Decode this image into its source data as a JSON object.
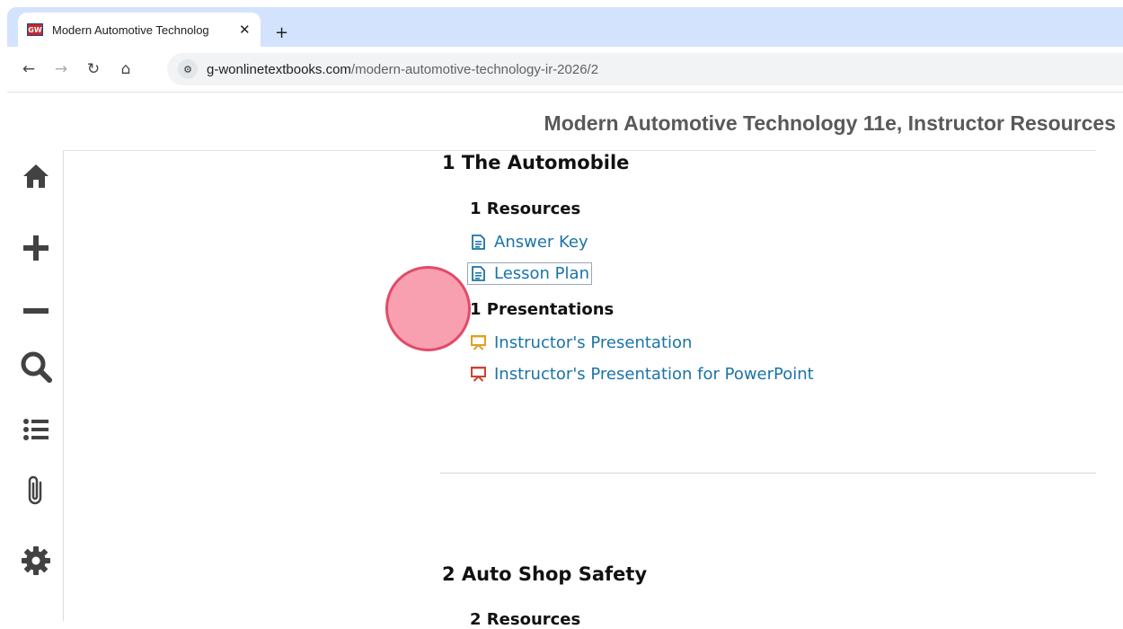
{
  "browser": {
    "tab": {
      "favicon_text": "GW",
      "title": "Modern Automotive Technolog",
      "close_glyph": "✕"
    },
    "new_tab_glyph": "+",
    "nav": {
      "back_glyph": "←",
      "forward_glyph": "→",
      "reload_glyph": "↻",
      "home_glyph": "⌂"
    },
    "address": {
      "site_info_glyph": "⚙",
      "host": "g-wonlinetextbooks.com",
      "path": "/modern-automotive-technology-ir-2026/2"
    }
  },
  "page": {
    "book_title": "Modern Automotive Technology 11e, Instructor Resources",
    "sidebar": {
      "items": [
        {
          "name": "home-icon"
        },
        {
          "name": "zoom-in-icon"
        },
        {
          "name": "zoom-out-icon"
        },
        {
          "name": "search-icon"
        },
        {
          "name": "list-icon"
        },
        {
          "name": "paperclip-icon"
        },
        {
          "name": "gear-icon"
        }
      ],
      "icon_color": "#424242"
    },
    "chapters": [
      {
        "heading": "1 The Automobile",
        "resources_heading": "1 Resources",
        "resources": [
          {
            "label": "Answer Key",
            "icon": "document-icon"
          },
          {
            "label": "Lesson Plan",
            "icon": "document-icon"
          }
        ],
        "presentations_heading": "1 Presentations",
        "presentations": [
          {
            "label": "Instructor's Presentation",
            "icon": "presentation-icon",
            "icon_color": "#e0a020"
          },
          {
            "label": "Instructor's Presentation for PowerPoint",
            "icon": "powerpoint-presentation-icon",
            "icon_color": "#c9452f"
          }
        ]
      },
      {
        "heading": "2 Auto Shop Safety",
        "resources_heading": "2 Resources"
      }
    ],
    "colors": {
      "link": "#1a73a8",
      "title": "#595959",
      "chrome_tabstrip": "#d3e3fd"
    }
  }
}
